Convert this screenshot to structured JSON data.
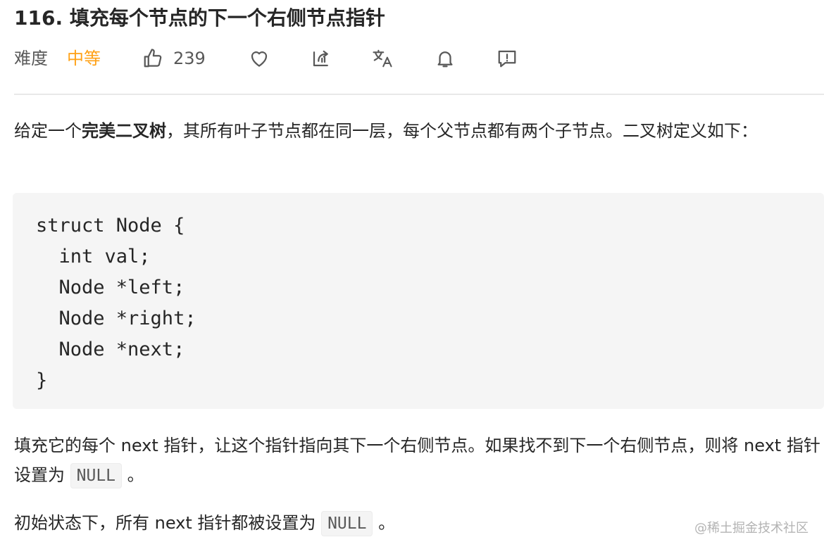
{
  "title": "116. 填充每个节点的下一个右侧节点指针",
  "meta": {
    "difficulty_label": "难度",
    "difficulty_value": "中等",
    "likes": "239",
    "level_color": "#ffa116",
    "icons": [
      "thumb-up-icon",
      "heart-icon",
      "share-icon",
      "translate-icon",
      "bell-icon",
      "comment-icon"
    ]
  },
  "intro": {
    "p1_a": "给定一个",
    "p1_bold": "完美二叉树",
    "p1_b": "，其所有叶子节点都在同一层，每个父节点都有两个子节点。二叉树定义如下："
  },
  "code": "struct Node {\n  int val;\n  Node *left;\n  Node *right;\n  Node *next;\n}",
  "para2": {
    "text_a": "填充它的每个 next 指针，让这个指针指向其下一个右侧节点。如果找不到下一个右侧节点，则将 next 指针设置为 ",
    "code": "NULL",
    "text_b": " 。"
  },
  "para3": {
    "text_a": "初始状态下，所有 next 指针都被设置为 ",
    "code": "NULL",
    "text_b": " 。"
  },
  "watermark": "@稀土掘金技术社区"
}
